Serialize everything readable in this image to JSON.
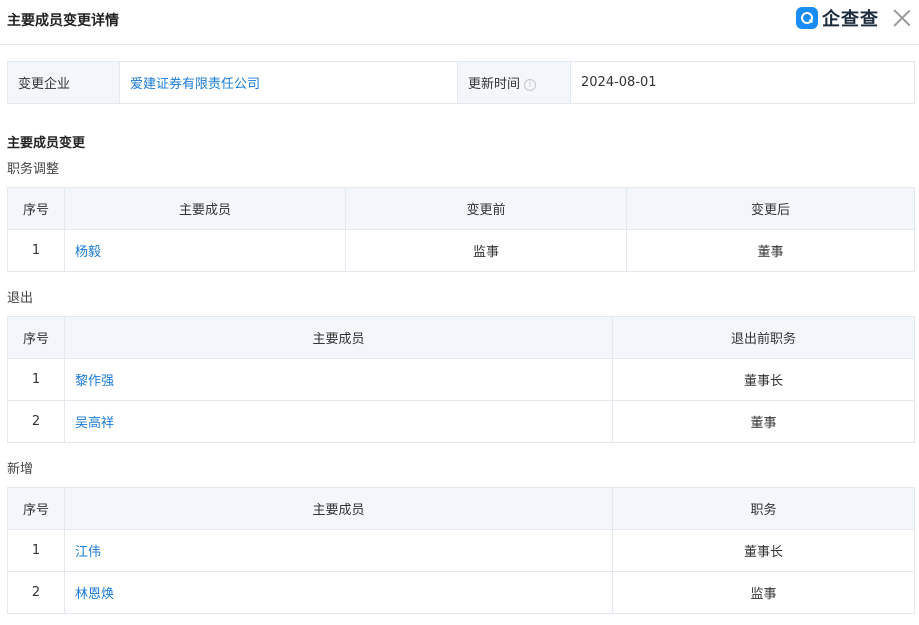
{
  "header": {
    "title": "主要成员变更详情",
    "brand": "企查查"
  },
  "info": {
    "company_label": "变更企业",
    "company_value": "爱建证券有限责任公司",
    "update_label": "更新时间",
    "update_value": "2024-08-01"
  },
  "section_title": "主要成员变更",
  "adjust": {
    "title": "职务调整",
    "headers": [
      "序号",
      "主要成员",
      "变更前",
      "变更后"
    ],
    "rows": [
      {
        "no": "1",
        "name": "杨毅",
        "before": "监事",
        "after": "董事"
      }
    ]
  },
  "exit": {
    "title": "退出",
    "headers": [
      "序号",
      "主要成员",
      "退出前职务"
    ],
    "rows": [
      {
        "no": "1",
        "name": "黎作强",
        "position": "董事长"
      },
      {
        "no": "2",
        "name": "吴高祥",
        "position": "董事"
      }
    ]
  },
  "added": {
    "title": "新增",
    "headers": [
      "序号",
      "主要成员",
      "职务"
    ],
    "rows": [
      {
        "no": "1",
        "name": "江伟",
        "position": "董事长"
      },
      {
        "no": "2",
        "name": "林恩焕",
        "position": "监事"
      }
    ]
  }
}
